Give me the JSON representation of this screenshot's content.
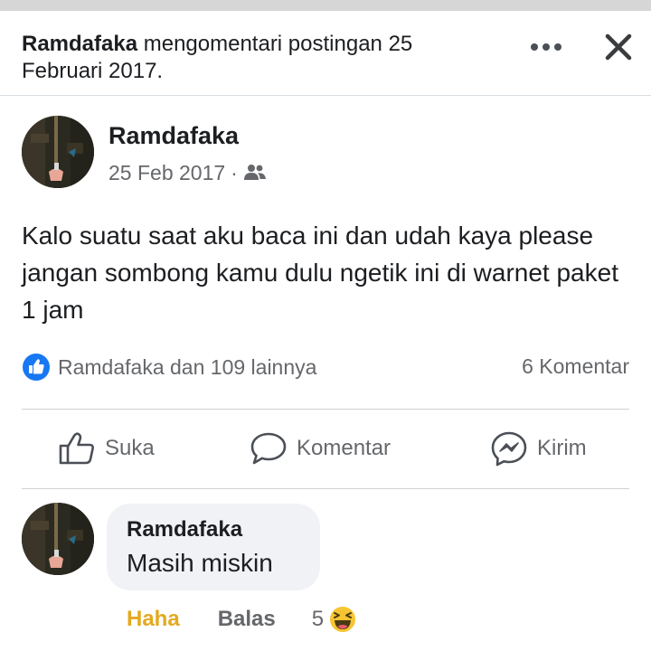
{
  "header": {
    "actor": "Ramdafaka",
    "action_text": " mengomentari postingan 25 Februari 2017."
  },
  "post": {
    "author": "Ramdafaka",
    "date": "25 Feb 2017",
    "separator": "·",
    "privacy_icon": "friends-icon",
    "body": "Kalo suatu saat aku baca ini dan udah kaya please jangan sombong kamu dulu ngetik ini di warnet paket 1 jam",
    "reactions_text": "Ramdafaka dan 109 lainnya",
    "comments_count": "6 Komentar"
  },
  "actions": {
    "like_label": "Suka",
    "comment_label": "Komentar",
    "send_label": "Kirim"
  },
  "comment": {
    "author": "Ramdafaka",
    "text": "Masih miskin",
    "haha_label": "Haha",
    "reply_label": "Balas",
    "reaction_count": "5"
  },
  "colors": {
    "facebook_blue": "#1877f2",
    "haha_yellow": "#e3a91e",
    "muted_text": "#65676b"
  }
}
